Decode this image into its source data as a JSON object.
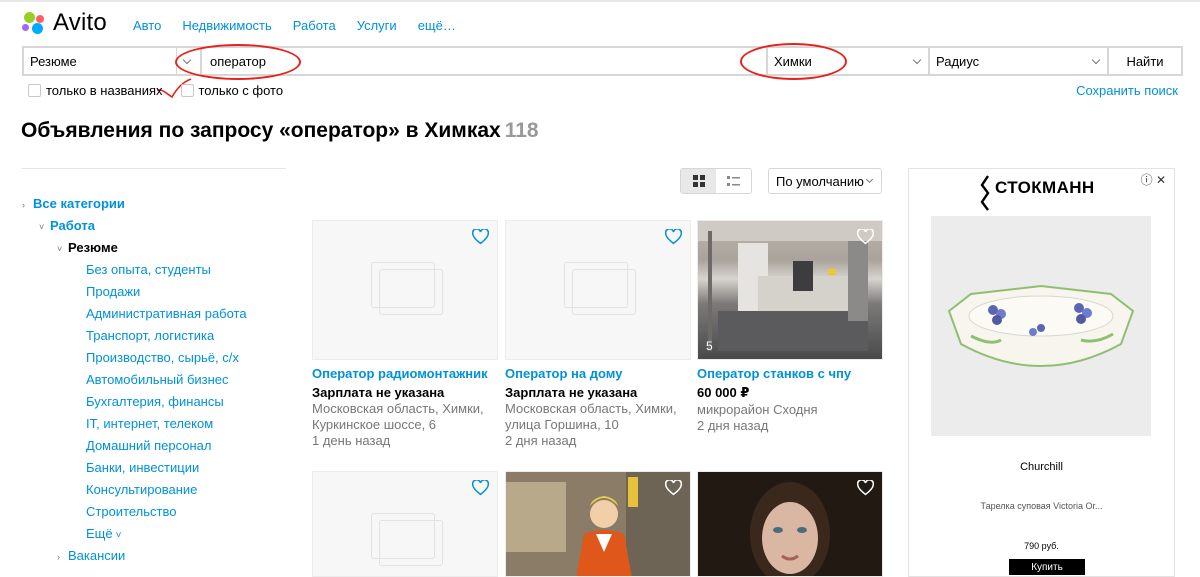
{
  "header": {
    "logo_text": "Avito",
    "nav": [
      "Авто",
      "Недвижимость",
      "Работа",
      "Услуги",
      "ещё…"
    ]
  },
  "search": {
    "category": "Резюме",
    "query": "оператор",
    "city": "Химки",
    "radius": "Радиус",
    "submit": "Найти",
    "only_titles": "только в названиях",
    "only_photo": "только с фото",
    "save_search": "Сохранить поиск"
  },
  "title": {
    "text": "Объявления по запросу «оператор» в Химках",
    "count": "118"
  },
  "sidebar": {
    "all_categories": "Все категории",
    "work": "Работа",
    "resume": "Резюме",
    "subcategories": [
      "Без опыта, студенты",
      "Продажи",
      "Административная работа",
      "Транспорт, логистика",
      "Производство, сырьё, с/х",
      "Автомобильный бизнес",
      "Бухгалтерия, финансы",
      "IT, интернет, телеком",
      "Домашний персонал",
      "Банки, инвестиции",
      "Консультирование",
      "Строительство"
    ],
    "more": "Ещё",
    "vacancies": "Вакансии"
  },
  "toolbar": {
    "sort": "По умолчанию"
  },
  "listings": [
    {
      "title": "Оператор радиомонтажник",
      "price": "Зарплата не указана",
      "address1": "Московская область, Химки,",
      "address2": "Куркинское шоссе, 6",
      "date": "1 день назад",
      "photos": ""
    },
    {
      "title": "Оператор на дому",
      "price": "Зарплата не указана",
      "address1": "Московская область, Химки,",
      "address2": "улица Горшина, 10",
      "date": "2 дня назад",
      "photos": ""
    },
    {
      "title": "Оператор станков с чпу",
      "price": "60 000 ₽",
      "address1": "микрорайон Сходня",
      "address2": "",
      "date": "2 дня назад",
      "photos": "5"
    }
  ],
  "ad": {
    "brand": "СТОКМАНН",
    "product_name": "Churchill",
    "description": "Тарелка суповая Victoria Or...",
    "price": "790 руб.",
    "buy": "Купить",
    "controls": "ⓘ ✕"
  },
  "colors": {
    "link": "#0091d9",
    "annotation": "#e8221b",
    "muted": "#777777"
  }
}
